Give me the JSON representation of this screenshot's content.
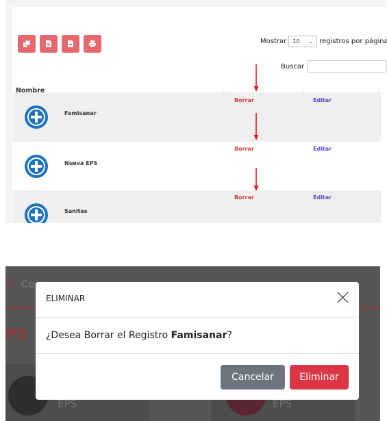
{
  "export_buttons": [
    {
      "icon": "copy-icon"
    },
    {
      "icon": "excel-file-icon"
    },
    {
      "icon": "pdf-file-icon"
    },
    {
      "icon": "print-icon"
    }
  ],
  "length_menu": {
    "prefix": "Mostrar",
    "value": "10",
    "suffix": "registros por página"
  },
  "search": {
    "label": "Buscar",
    "value": ""
  },
  "table": {
    "header_name": "Nombre",
    "rows": [
      {
        "name": "Famisanar",
        "delete_label": "Borrar",
        "edit_label": "Editar"
      },
      {
        "name": "Nueva EPS",
        "delete_label": "Borrar",
        "edit_label": "Editar"
      },
      {
        "name": "Sanitas",
        "delete_label": "Borrar",
        "edit_label": "Editar"
      }
    ]
  },
  "background": {
    "tab_text": "Cons",
    "heading": "PS",
    "card_label_left": "EPS",
    "card_label_right": "EPS"
  },
  "modal": {
    "title": "ELIMINAR",
    "message_prefix": "¿Desea Borrar el Registro ",
    "record_name": "Famisanar",
    "message_suffix": "?",
    "cancel_label": "Cancelar",
    "delete_label": "Eliminar"
  },
  "colors": {
    "export_button": "#e5686f",
    "delete_link": "#d83c3c",
    "edit_link": "#5548c8",
    "plus_icon": "#1e72c0",
    "cancel_button": "#6c757d",
    "delete_button": "#dc3545"
  }
}
